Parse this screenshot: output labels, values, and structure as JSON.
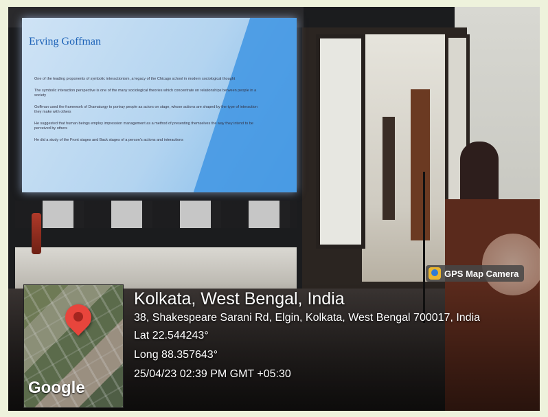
{
  "slide": {
    "title": "Erving Goffman",
    "bullets": [
      "One of the leading proponents of symbolic interactionism, a legacy of the Chicago school in modern sociological thought",
      "The symbolic interaction perspective is one of the many sociological theories which concentrate on relationships between people in a society",
      "Goffman used the framework of Dramaturgy to portray people as actors on stage, whose actions are shaped by the type of interaction they make with others",
      "He suggested that human beings employ impression management as a method of presenting themselves the way they intend to be perceived by others",
      "He did a study of the Front stages and Back stages of a person's actions and interactions"
    ]
  },
  "gps": {
    "badge_label": "GPS Map Camera",
    "location": "Kolkata, West Bengal, India",
    "address": "38, Shakespeare Sarani Rd, Elgin, Kolkata, West Bengal 700017, India",
    "lat": "Lat 22.544243°",
    "long": "Long 88.357643°",
    "datetime": "25/04/23 02:39 PM GMT +05:30",
    "map_brand": "Google"
  },
  "icons": {
    "pin": "map-pin-icon",
    "badge": "gps-camera-icon"
  },
  "colors": {
    "pin": "#e8453c",
    "slide_accent": "#3f95e3"
  }
}
